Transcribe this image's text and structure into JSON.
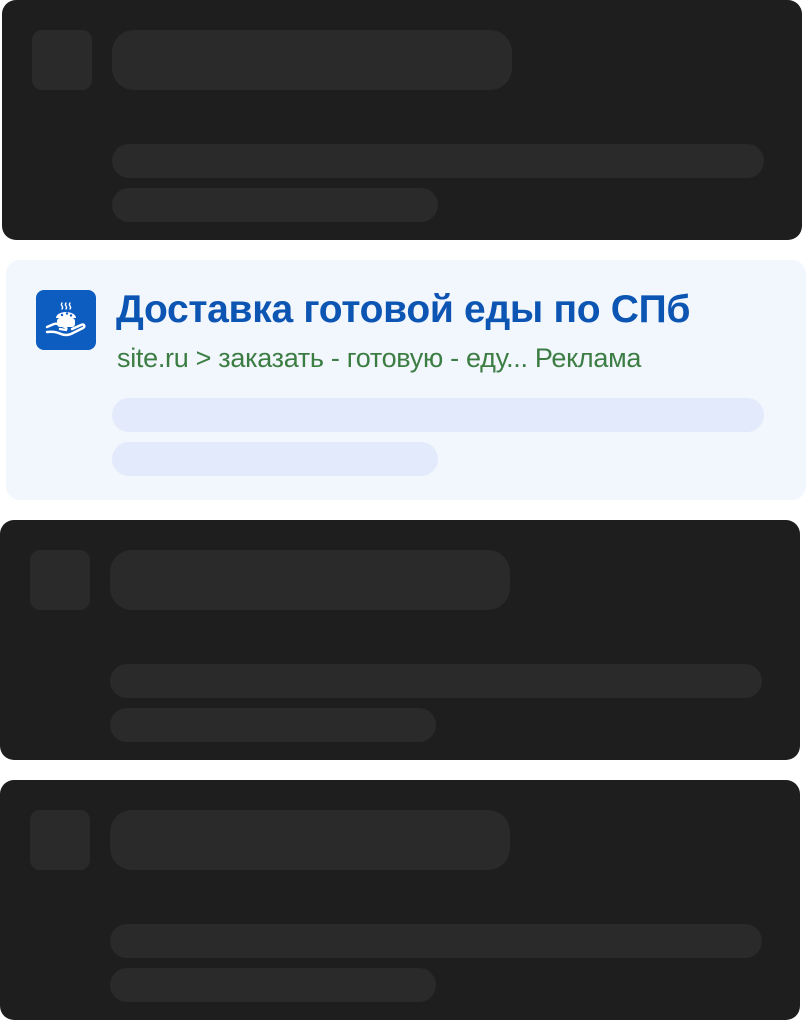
{
  "ad": {
    "icon": "food-delivery-hand-icon",
    "title": "Доставка готовой еды по СПб",
    "url": "site.ru > заказать - готовую - еду...",
    "label": "Реклама"
  },
  "colors": {
    "card_dark": "#1e1e1e",
    "skeleton_dark": "#2a2a2a",
    "ad_background": "#f2f6fd",
    "ad_skeleton": "#e2eafb",
    "ad_title": "#0d55b3",
    "ad_url": "#3b7d43",
    "ad_icon_bg": "#0d5cbf"
  }
}
